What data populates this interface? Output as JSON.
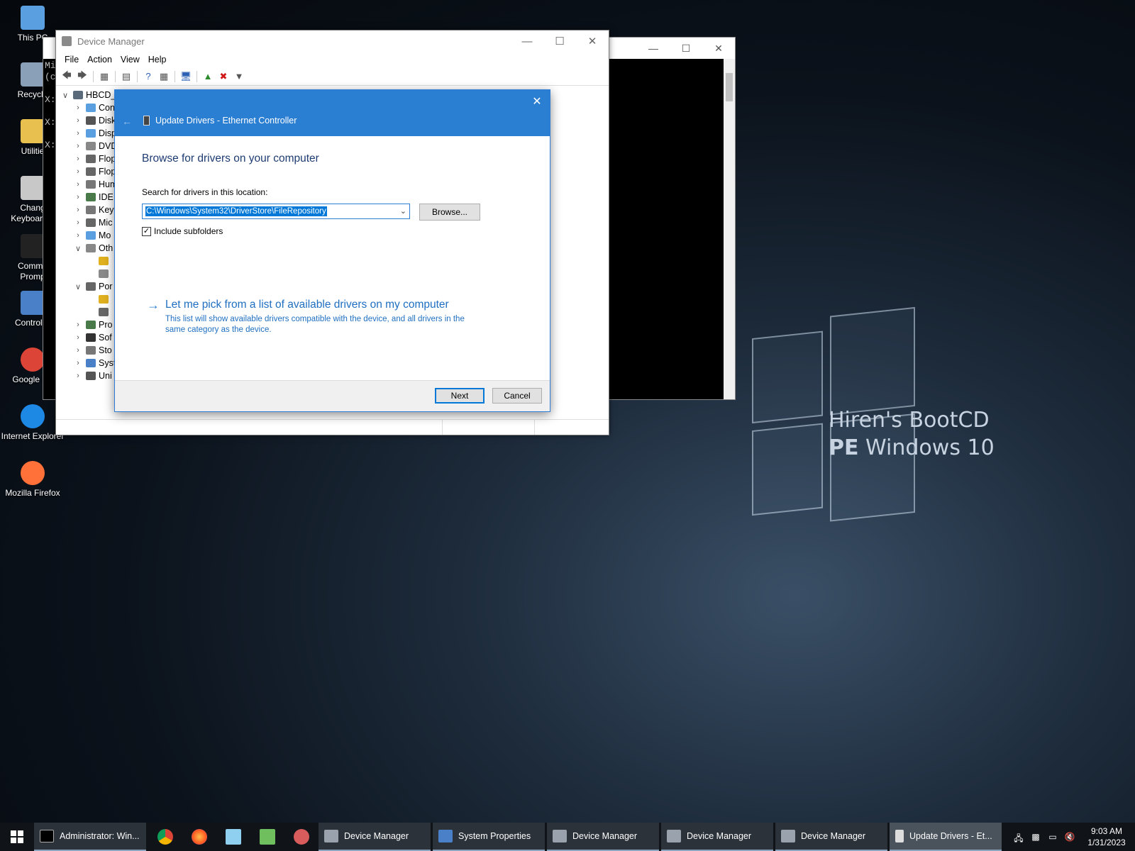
{
  "desktop": {
    "icons": [
      {
        "label": "This PC"
      },
      {
        "label": "Recycle"
      },
      {
        "label": "Utilitie"
      },
      {
        "label": "Chang\nKeyboard L"
      },
      {
        "label": "Comma\nPromp"
      },
      {
        "label": "Control P"
      },
      {
        "label": "Google Ch"
      },
      {
        "label": "Internet Explorer"
      },
      {
        "label": "Mozilla Firefox"
      }
    ],
    "wallpaper_line1": "Hiren's BootCD",
    "wallpaper_line2_bold": "PE",
    "wallpaper_line2_rest": "Windows 10"
  },
  "console": {
    "lines": [
      "Mic",
      "(c",
      "",
      "X:",
      "",
      "X:",
      "",
      "X:"
    ]
  },
  "device_manager": {
    "title": "Device Manager",
    "menu": [
      "File",
      "Action",
      "View",
      "Help"
    ],
    "tree": [
      {
        "label": "HBCD_",
        "arrow": "open",
        "indent": 0
      },
      {
        "label": "Con",
        "arrow": "closed",
        "indent": 1
      },
      {
        "label": "Disk",
        "arrow": "closed",
        "indent": 1
      },
      {
        "label": "Disp",
        "arrow": "closed",
        "indent": 1
      },
      {
        "label": "DVD",
        "arrow": "closed",
        "indent": 1
      },
      {
        "label": "Flop",
        "arrow": "closed",
        "indent": 1
      },
      {
        "label": "Flop",
        "arrow": "closed",
        "indent": 1
      },
      {
        "label": "Hum",
        "arrow": "closed",
        "indent": 1
      },
      {
        "label": "IDE",
        "arrow": "closed",
        "indent": 1
      },
      {
        "label": "Key",
        "arrow": "closed",
        "indent": 1
      },
      {
        "label": "Mic",
        "arrow": "closed",
        "indent": 1
      },
      {
        "label": "Mo",
        "arrow": "closed",
        "indent": 1
      },
      {
        "label": "Oth",
        "arrow": "open",
        "indent": 1
      },
      {
        "label": "",
        "arrow": "none",
        "indent": 2
      },
      {
        "label": "",
        "arrow": "none",
        "indent": 2
      },
      {
        "label": "Por",
        "arrow": "open",
        "indent": 1
      },
      {
        "label": "",
        "arrow": "none",
        "indent": 2
      },
      {
        "label": "",
        "arrow": "none",
        "indent": 2
      },
      {
        "label": "Pro",
        "arrow": "closed",
        "indent": 1
      },
      {
        "label": "Sof",
        "arrow": "closed",
        "indent": 1
      },
      {
        "label": "Sto",
        "arrow": "closed",
        "indent": 1
      },
      {
        "label": "Syst",
        "arrow": "closed",
        "indent": 1
      },
      {
        "label": "Uni",
        "arrow": "closed",
        "indent": 1
      }
    ]
  },
  "update_dialog": {
    "title": "Update Drivers - Ethernet Controller",
    "heading": "Browse for drivers on your computer",
    "search_label": "Search for drivers in this location:",
    "location_value": "C:\\Windows\\System32\\DriverStore\\FileRepository",
    "browse_label": "Browse...",
    "include_subfolders_label": "Include subfolders",
    "include_subfolders_checked": true,
    "pick_link_title": "Let me pick from a list of available drivers on my computer",
    "pick_link_desc": "This list will show available drivers compatible with the device, and all drivers in the same category as the device.",
    "next_label": "Next",
    "cancel_label": "Cancel"
  },
  "taskbar": {
    "windows": [
      {
        "label": "Administrator: Win...",
        "icon": "cmd-icon"
      },
      {
        "label": "Device Manager",
        "icon": "device-manager-icon"
      },
      {
        "label": "System Properties",
        "icon": "system-properties-icon"
      },
      {
        "label": "Device Manager",
        "icon": "device-manager-icon"
      },
      {
        "label": "Device Manager",
        "icon": "device-manager-icon"
      },
      {
        "label": "Device Manager",
        "icon": "device-manager-icon"
      },
      {
        "label": "Update Drivers - Et...",
        "icon": "device-icon"
      }
    ],
    "pinned": [
      "chrome-icon",
      "firefox-icon",
      "notepad-icon",
      "task-icon",
      "paint-icon"
    ],
    "clock_time": "9:03 AM",
    "clock_date": "1/31/2023"
  },
  "colors": {
    "accent": "#2b7fd2",
    "link": "#1f6fc1",
    "selection": "#0078d7"
  }
}
